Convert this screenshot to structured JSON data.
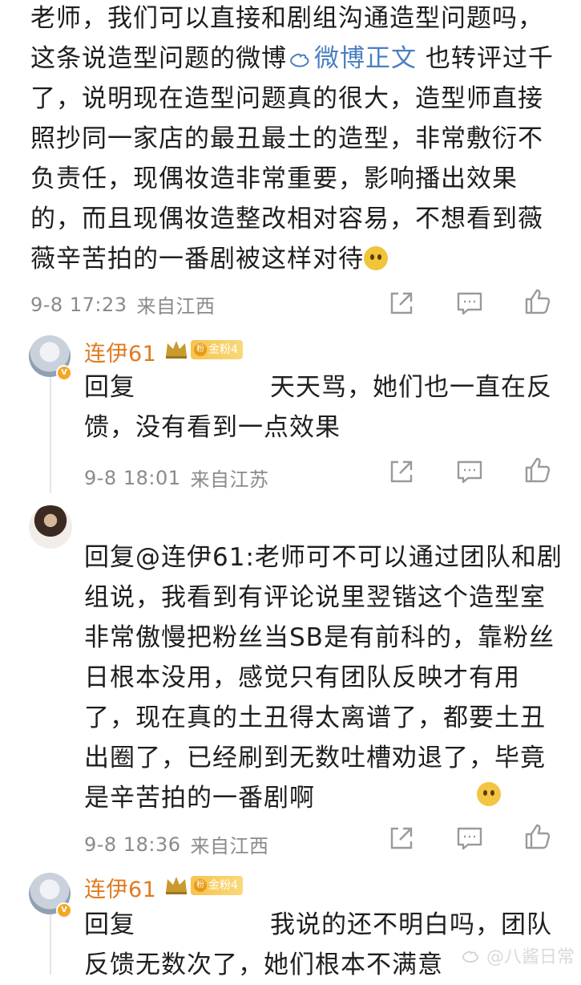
{
  "main_comment": {
    "text_before_link": "老师，我们可以直接和剧组沟通造型问题吗，这条说造型问题的微博",
    "link_text": "微博正文",
    "text_after_link": " 也转评过千了，说明现在造型问题真的很大，造型师直接照抄同一家店的最丑最土的造型，非常敷衍不负责任，现偶妆造非常重要，影响播出效果的，而且现偶妆造整改相对容易，不想看到薇薇辛苦拍的一番剧被这样对待",
    "time": "9-8 17:23",
    "location": "来自江西"
  },
  "replies": [
    {
      "username": "连伊61",
      "fan_badge": "金粉4",
      "text_prefix": "回复",
      "text_after_redaction": "天天骂，她们也一直在反馈，没有看到一点效果",
      "time": "9-8 18:01",
      "location": "来自江苏"
    },
    {
      "username": "",
      "text": "回复@连伊61:老师可不可以通过团队和剧组说，我看到有评论说里翌锴这个造型室非常傲慢把粉丝当SB是有前科的，靠粉丝日根本没用，感觉只有团队反映才有用了，现在真的土丑得太离谱了，都要土丑出圈了，已经刷到无数吐槽劝退了，毕竟是辛苦拍的一番剧啊",
      "time": "9-8 18:36",
      "location": "来自江西"
    },
    {
      "username": "连伊61",
      "fan_badge": "金粉4",
      "text_prefix": "回复",
      "text_after_redaction": "我说的还不明白吗，团队反馈无数次了，她们根本不满意",
      "time": "",
      "location": ""
    }
  ],
  "icons": [
    "share-icon",
    "comment-icon",
    "like-icon",
    "weibo-icon",
    "crown-icon"
  ],
  "watermark": "@八酱日常",
  "colors": {
    "link": "#4a7fc1",
    "username": "#e07a1f",
    "meta": "#8a8a8a",
    "badge": "#f6c34f"
  }
}
